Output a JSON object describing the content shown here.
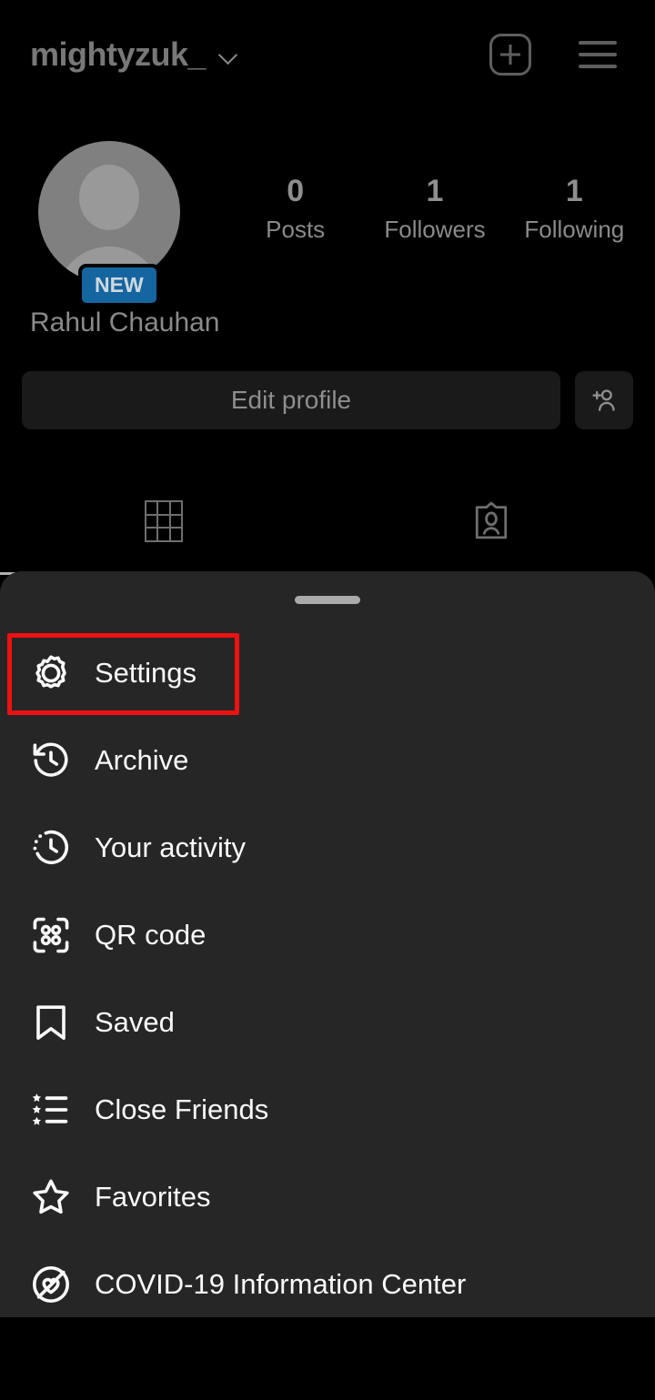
{
  "header": {
    "username": "mightyzuk_",
    "dropdown_icon": "chevron-down-icon",
    "create_icon": "plus-square-icon",
    "menu_icon": "hamburger-menu-icon"
  },
  "profile": {
    "avatar_icon": "default-avatar-icon",
    "new_badge": "NEW",
    "full_name": "Rahul Chauhan",
    "stats": [
      {
        "value": "0",
        "label": "Posts"
      },
      {
        "value": "1",
        "label": "Followers"
      },
      {
        "value": "1",
        "label": "Following"
      }
    ],
    "edit_profile_label": "Edit profile",
    "add_person_icon": "add-person-icon"
  },
  "tabs": [
    {
      "name": "grid",
      "icon": "grid-icon",
      "active": true
    },
    {
      "name": "tagged",
      "icon": "tagged-person-icon",
      "active": false
    }
  ],
  "sheet": {
    "handle": "drag-handle",
    "items": [
      {
        "label": "Settings",
        "icon": "gear-icon",
        "highlighted": true
      },
      {
        "label": "Archive",
        "icon": "archive-clock-icon",
        "highlighted": false
      },
      {
        "label": "Your activity",
        "icon": "activity-clock-icon",
        "highlighted": false
      },
      {
        "label": "QR code",
        "icon": "qr-code-icon",
        "highlighted": false
      },
      {
        "label": "Saved",
        "icon": "bookmark-icon",
        "highlighted": false
      },
      {
        "label": "Close Friends",
        "icon": "star-list-icon",
        "highlighted": false
      },
      {
        "label": "Favorites",
        "icon": "star-icon",
        "highlighted": false
      },
      {
        "label": "COVID-19 Information Center",
        "icon": "heart-circle-icon",
        "highlighted": false
      }
    ]
  },
  "colors": {
    "background": "#000000",
    "sheet_background": "#262626",
    "highlight": "#ee1111",
    "badge_blue": "#1565a0",
    "label_text": "#fafafa",
    "muted_text": "#8a8a8a"
  }
}
